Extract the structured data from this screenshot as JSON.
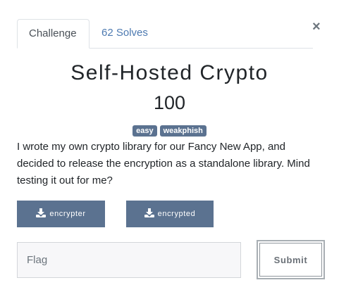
{
  "tabs": {
    "challenge_label": "Challenge",
    "solves_label": "62 Solves"
  },
  "close_symbol": "×",
  "challenge": {
    "title": "Self-Hosted Crypto",
    "points": "100",
    "tags": [
      "easy",
      "weakphish"
    ],
    "description": "I wrote my own crypto library for our Fancy New App, and decided to release the encryption as a standalone library. Mind testing it out for me?"
  },
  "files": [
    {
      "label": "encrypter",
      "icon": "download-icon"
    },
    {
      "label": "encrypted",
      "icon": "download-icon"
    }
  ],
  "flag_form": {
    "placeholder": "Flag",
    "submit_label": "Submit"
  },
  "colors": {
    "accent_link": "#4d7ab1",
    "badge_bg": "#5b7290",
    "file_button_bg": "#5b7290"
  }
}
